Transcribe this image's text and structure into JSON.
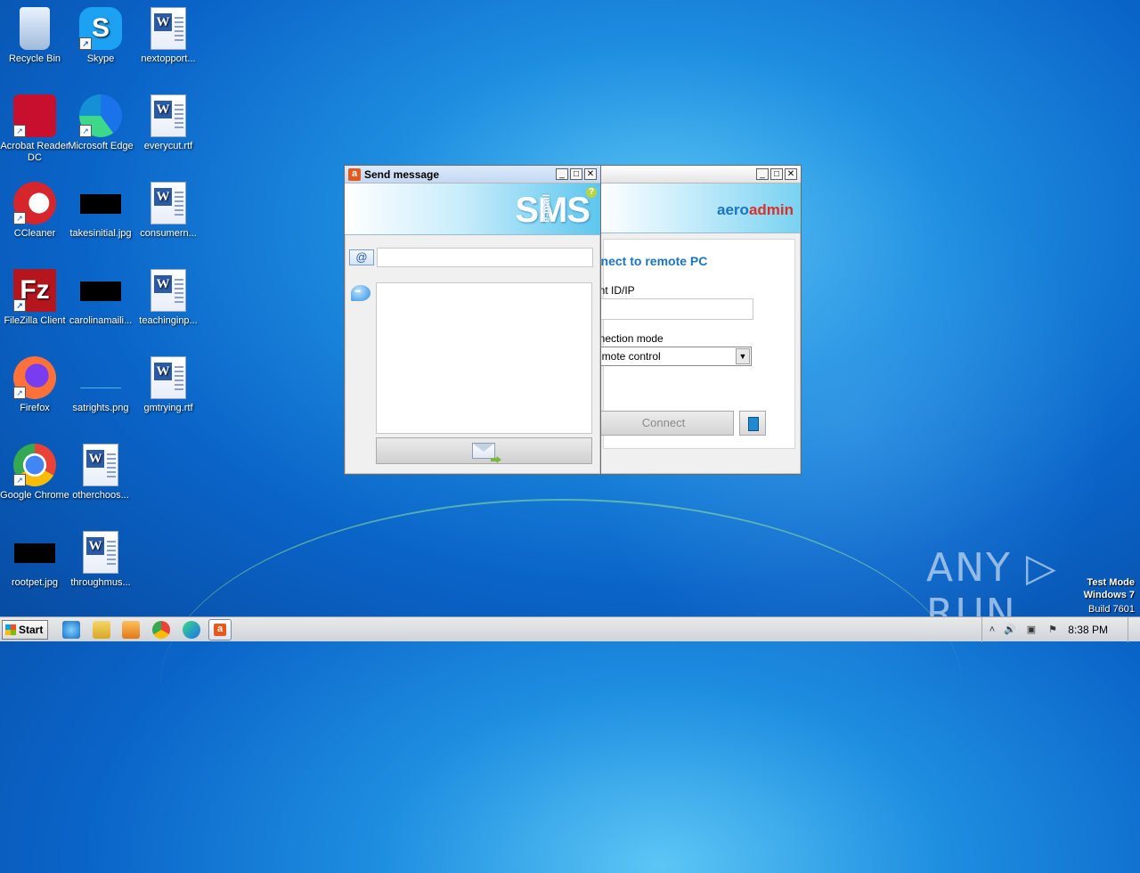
{
  "desktop": {
    "icons": [
      {
        "label": "Recycle Bin",
        "icon": "recycle-bin-icon"
      },
      {
        "label": "Skype",
        "icon": "skype-icon"
      },
      {
        "label": "nextopport...",
        "icon": "word-doc-icon"
      },
      {
        "label": "Acrobat Reader DC",
        "icon": "acrobat-icon"
      },
      {
        "label": "Microsoft Edge",
        "icon": "edge-icon"
      },
      {
        "label": "everycut.rtf",
        "icon": "word-doc-icon"
      },
      {
        "label": "CCleaner",
        "icon": "ccleaner-icon"
      },
      {
        "label": "takesinitial.jpg",
        "icon": "image-thumb-icon"
      },
      {
        "label": "consumern...",
        "icon": "word-doc-icon"
      },
      {
        "label": "FileZilla Client",
        "icon": "filezilla-icon"
      },
      {
        "label": "carolinamaili...",
        "icon": "image-thumb-icon"
      },
      {
        "label": "teachinginp...",
        "icon": "word-doc-icon"
      },
      {
        "label": "Firefox",
        "icon": "firefox-icon"
      },
      {
        "label": "satrights.png",
        "icon": "image-thumb-icon"
      },
      {
        "label": "gmtrying.rtf",
        "icon": "word-doc-icon"
      },
      {
        "label": "Google Chrome",
        "icon": "chrome-icon"
      },
      {
        "label": "otherchoos...",
        "icon": "word-doc-icon"
      },
      {
        "label": "rootpet.jpg",
        "icon": "image-thumb-icon"
      },
      {
        "label": "throughmus...",
        "icon": "word-doc-icon"
      }
    ]
  },
  "aeroadmin": {
    "logo_aero": "aero",
    "logo_admin": "admin",
    "heading": "nnect to remote PC",
    "client_label": "ent ID/IP",
    "client_value": "",
    "mode_label": "nnection mode",
    "mode_value": "emote control",
    "connect_label": "Connect"
  },
  "send_message": {
    "title": "Send message",
    "logo_sms": "SMS",
    "logo_email": "e-mail",
    "help": "?",
    "to_value": "",
    "message_value": ""
  },
  "watermark": {
    "text": "ANY ▷ RUN",
    "line1": "Test Mode",
    "line2": "Windows 7",
    "line3": "Build 7601"
  },
  "taskbar": {
    "start_label": "Start",
    "clock": "8:38 PM"
  },
  "colors": {
    "accent": "#1975bf",
    "aero_red": "#d9312a",
    "sms_orange": "#e55a1c"
  }
}
